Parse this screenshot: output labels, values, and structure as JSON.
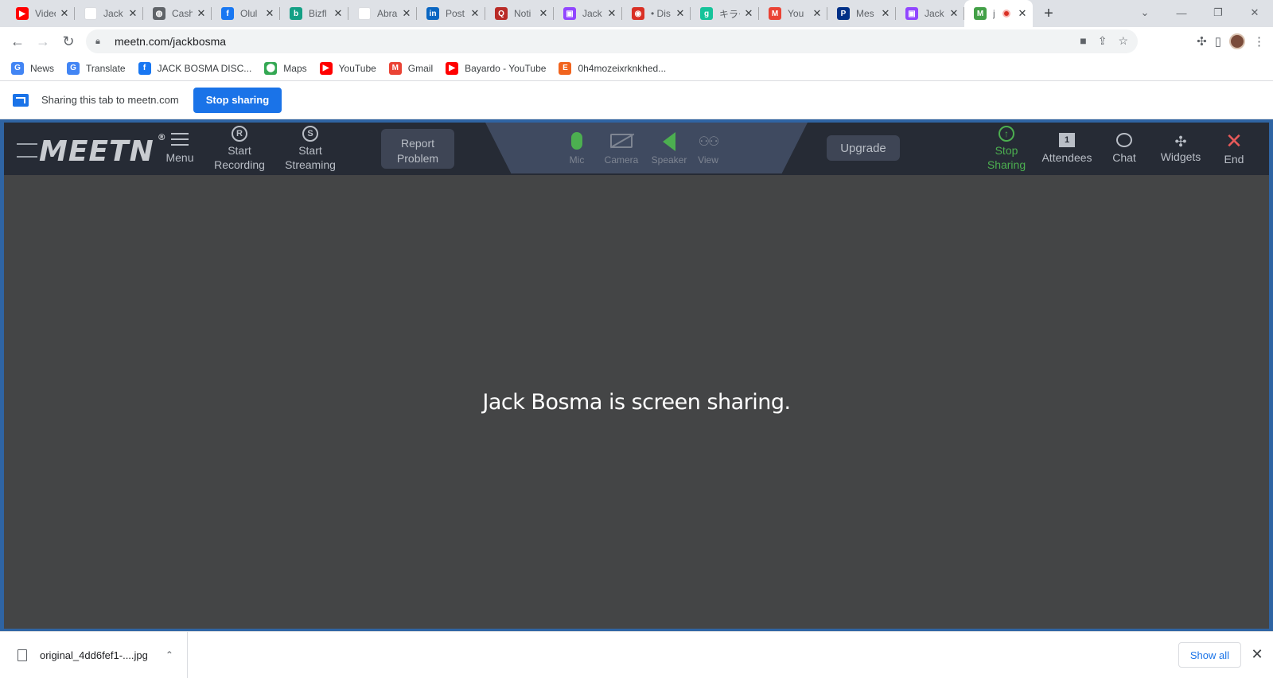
{
  "tabs": [
    {
      "title": "Video",
      "icon": "youtube-icon",
      "color": "#ff0000",
      "glyph": "▶"
    },
    {
      "title": "Jack",
      "icon": "blank-page-icon",
      "color": "#ffffff",
      "glyph": ""
    },
    {
      "title": "Cash",
      "icon": "globe-icon",
      "color": "#5f6368",
      "glyph": "◍"
    },
    {
      "title": "Olul",
      "icon": "facebook-icon",
      "color": "#1877f2",
      "glyph": "f"
    },
    {
      "title": "Bizfl",
      "icon": "bizfluent-icon",
      "color": "#14a085",
      "glyph": "b"
    },
    {
      "title": "Abra",
      "icon": "blank-page-icon",
      "color": "#ffffff",
      "glyph": ""
    },
    {
      "title": "Post",
      "icon": "linkedin-icon",
      "color": "#0a66c2",
      "glyph": "in"
    },
    {
      "title": "Noti",
      "icon": "quora-icon",
      "color": "#b92b27",
      "glyph": "Q"
    },
    {
      "title": "Jack",
      "icon": "twitch-icon",
      "color": "#9146ff",
      "glyph": "▣"
    },
    {
      "title": "• Dis",
      "icon": "discord-icon",
      "color": "#d93025",
      "glyph": "◉"
    },
    {
      "title": "キラー",
      "icon": "grammarly-icon",
      "color": "#15c39a",
      "glyph": "g"
    },
    {
      "title": "You",
      "icon": "gmail-icon",
      "color": "#ea4335",
      "glyph": "M"
    },
    {
      "title": "Mes",
      "icon": "paypal-icon",
      "color": "#003087",
      "glyph": "P"
    },
    {
      "title": "Jack",
      "icon": "twitch-icon",
      "color": "#9146ff",
      "glyph": "▣"
    },
    {
      "title": "j",
      "icon": "meetn-icon",
      "color": "#43a047",
      "glyph": "M",
      "active": true
    }
  ],
  "window": {
    "minimize": "—",
    "restore": "❐",
    "close": "✕",
    "dropdown": "⌄",
    "new_tab": "+"
  },
  "address": {
    "url": "meetn.com/jackbosma"
  },
  "bookmarks": [
    {
      "label": "News",
      "icon": "google-news-icon",
      "color": "#4285f4",
      "glyph": "G"
    },
    {
      "label": "Translate",
      "icon": "google-translate-icon",
      "color": "#4285f4",
      "glyph": "G"
    },
    {
      "label": "JACK BOSMA DISC...",
      "icon": "facebook-icon",
      "color": "#1877f2",
      "glyph": "f"
    },
    {
      "label": "Maps",
      "icon": "google-maps-icon",
      "color": "#34a853",
      "glyph": "⬤"
    },
    {
      "label": "YouTube",
      "icon": "youtube-icon",
      "color": "#ff0000",
      "glyph": "▶"
    },
    {
      "label": "Gmail",
      "icon": "gmail-icon",
      "color": "#ea4335",
      "glyph": "M"
    },
    {
      "label": "Bayardo - YouTube",
      "icon": "youtube-icon",
      "color": "#ff0000",
      "glyph": "▶"
    },
    {
      "label": "0h4mozeixrknkhed...",
      "icon": "etsy-icon",
      "color": "#f1641e",
      "glyph": "E"
    }
  ],
  "infobar": {
    "message": "Sharing this tab to meetn.com",
    "button": "Stop sharing"
  },
  "meetn": {
    "logo": "MEETN",
    "logo_reg": "®",
    "menu": "Menu",
    "start_recording": [
      "Start",
      "Recording"
    ],
    "start_streaming": [
      "Start",
      "Streaming"
    ],
    "report_problem": [
      "Report",
      "Problem"
    ],
    "mic": "Mic",
    "camera": "Camera",
    "speaker": "Speaker",
    "view": "View",
    "upgrade": "Upgrade",
    "stop_sharing": [
      "Stop",
      "Sharing"
    ],
    "attendees": "Attendees",
    "attendee_count": "1",
    "chat": "Chat",
    "widgets": "Widgets",
    "end": "End",
    "stage_message": "Jack Bosma is screen sharing.",
    "recording_glyph": "R",
    "streaming_glyph": "S"
  },
  "downloads": {
    "file": "original_4dd6fef1-....jpg",
    "show_all": "Show all"
  },
  "colors": {
    "accent_blue": "#1a73e8",
    "meetn_green": "#4caf50",
    "meetn_red": "#e85a5a",
    "meetn_bar": "#262b35",
    "stage": "#444546"
  }
}
